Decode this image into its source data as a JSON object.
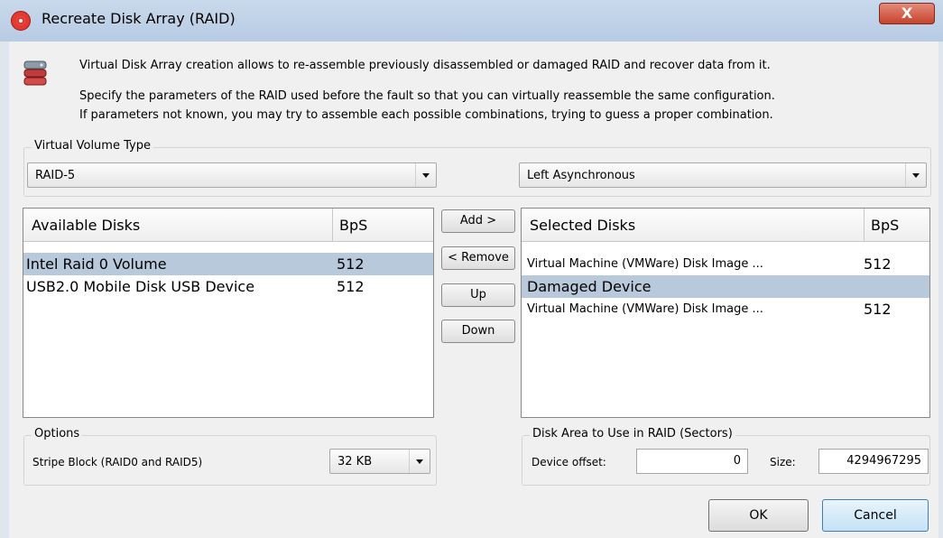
{
  "window": {
    "title": "Recreate Disk Array (RAID)",
    "close_glyph": "X"
  },
  "intro": {
    "line1": "Virtual Disk Array creation allows to re-assemble previously disassembled or damaged RAID and recover data from it.",
    "line2": "Specify the parameters of the RAID used before the fault so that you can virtually reassemble the same configuration.",
    "line3": "If parameters not known, you may try to assemble each possible combinations, trying to guess a proper combination."
  },
  "volume_type": {
    "label": "Virtual Volume Type",
    "type_value": "RAID-5",
    "layout_value": "Left Asynchronous"
  },
  "available": {
    "col_name": "Available Disks",
    "col_bps": "BpS",
    "rows": [
      {
        "name": "Intel   Raid 0 Volume",
        "bps": "512",
        "selected": true
      },
      {
        "name": "USB2.0 Mobile Disk USB Device",
        "bps": "512",
        "selected": false
      }
    ]
  },
  "actions": {
    "add": "Add >",
    "remove": "< Remove",
    "up": "Up",
    "down": "Down"
  },
  "selected": {
    "col_name": "Selected Disks",
    "col_bps": "BpS",
    "rows": [
      {
        "name": "Virtual Machine (VMWare) Disk Image ...",
        "bps": "512",
        "selected": false
      },
      {
        "name": "Damaged Device",
        "bps": "",
        "selected": true
      },
      {
        "name": "Virtual Machine (VMWare) Disk Image ...",
        "bps": "512",
        "selected": false
      }
    ]
  },
  "options": {
    "label": "Options",
    "stripe_label": "Stripe Block (RAID0 and RAID5)",
    "stripe_value": "32 KB"
  },
  "disk_area": {
    "label": "Disk Area to Use in RAID (Sectors)",
    "offset_label": "Device offset:",
    "offset_value": "0",
    "size_label": "Size:",
    "size_value": "4294967295"
  },
  "footer": {
    "ok": "OK",
    "cancel": "Cancel"
  },
  "colors": {
    "selection": "#b9c9dc",
    "titlebar": "#c9d9ec",
    "close": "#c7432c"
  },
  "icons": {
    "app": "raid-app-icon",
    "disk": "disk-stack-icon"
  }
}
